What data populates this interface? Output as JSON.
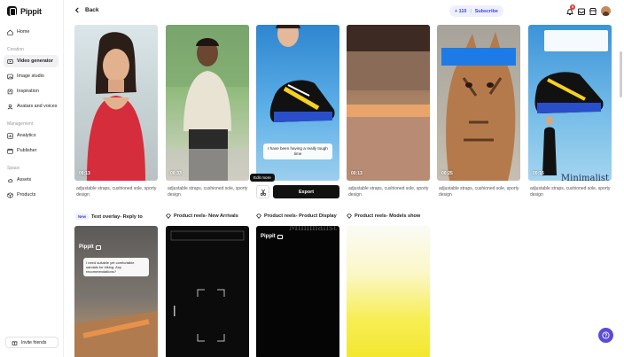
{
  "app": {
    "name": "Pippit"
  },
  "sidebar": {
    "home": "Home",
    "section_creation": "Creation",
    "creation_items": [
      "Video generator",
      "Image studio",
      "Inspiration",
      "Avatars and voices"
    ],
    "section_management": "Management",
    "management_items": [
      "Analytics",
      "Publisher"
    ],
    "section_space": "Space",
    "space_items": [
      "Assets",
      "Products"
    ],
    "invite": "Invite friends"
  },
  "topbar": {
    "back": "Back",
    "credits": "+ 110",
    "subscribe": "Subscribe",
    "notification_count": "5"
  },
  "row1": [
    {
      "duration": "00:13",
      "caption": "adjustable straps, cushioned sole, sporty design"
    },
    {
      "duration": "00:33",
      "caption": "adjustable straps, cushioned sole, sporty design"
    },
    {
      "duration": "",
      "caption": "",
      "subtitle": "I have been having a really tough time"
    },
    {
      "duration": "00:13",
      "caption": "adjustable straps, cushioned sole, sporty design"
    },
    {
      "duration": "00:25",
      "caption": "adjustable straps, cushioned sole, sporty design"
    },
    {
      "duration": "00:16",
      "caption": "adjustable straps, cushioned sole, sporty design",
      "overlay_text": "Minimalist"
    }
  ],
  "hover": {
    "edit_more": "Edit more",
    "export": "Export"
  },
  "row2": [
    {
      "tag": "New",
      "title": "Text overlay- Reply to",
      "brand": "Pippit",
      "reply_text": "I need suitable yet comfortable sandals for hiking. Any recommendations?"
    },
    {
      "tag": "",
      "title": "Product reels- New Arrivals"
    },
    {
      "tag": "",
      "title": "Product reels- Product Display",
      "brand": "Pippit",
      "overlay_text": "Minimalist"
    },
    {
      "tag": "",
      "title": "Product reels- Models show"
    }
  ]
}
